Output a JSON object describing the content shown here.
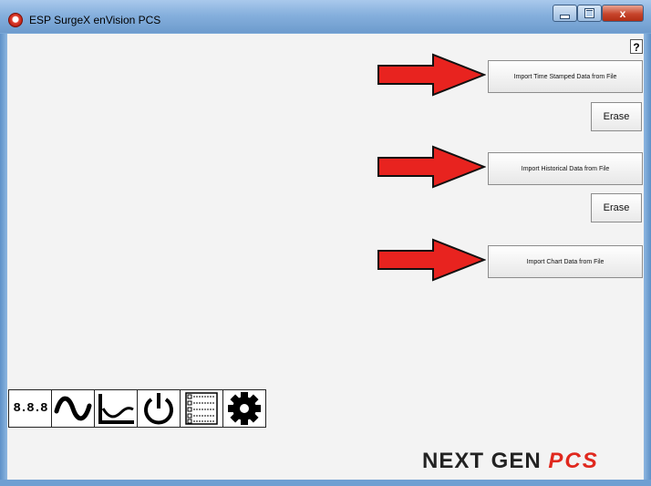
{
  "window": {
    "title": "ESP SurgeX enVision PCS",
    "controls": {
      "minimize": "–",
      "maximize": "□",
      "close": "x"
    }
  },
  "help_label": "?",
  "sections": [
    {
      "import_label": "Import Time Stamped Data from File",
      "erase_label": "Erase"
    },
    {
      "import_label": "Import Historical Data from File",
      "erase_label": "Erase"
    },
    {
      "import_label": "Import Chart Data from File"
    }
  ],
  "toolbar": {
    "meter_label": "8.8.8",
    "icons": [
      "digital-meter-icon",
      "waveform-icon",
      "trend-chart-icon",
      "power-icon",
      "event-list-icon",
      "settings-gear-icon"
    ]
  },
  "brand": {
    "next_gen": "NEXT GEN",
    "pcs": "PCS"
  },
  "colors": {
    "arrow": "#e8231f",
    "brand_accent": "#e0281e"
  }
}
